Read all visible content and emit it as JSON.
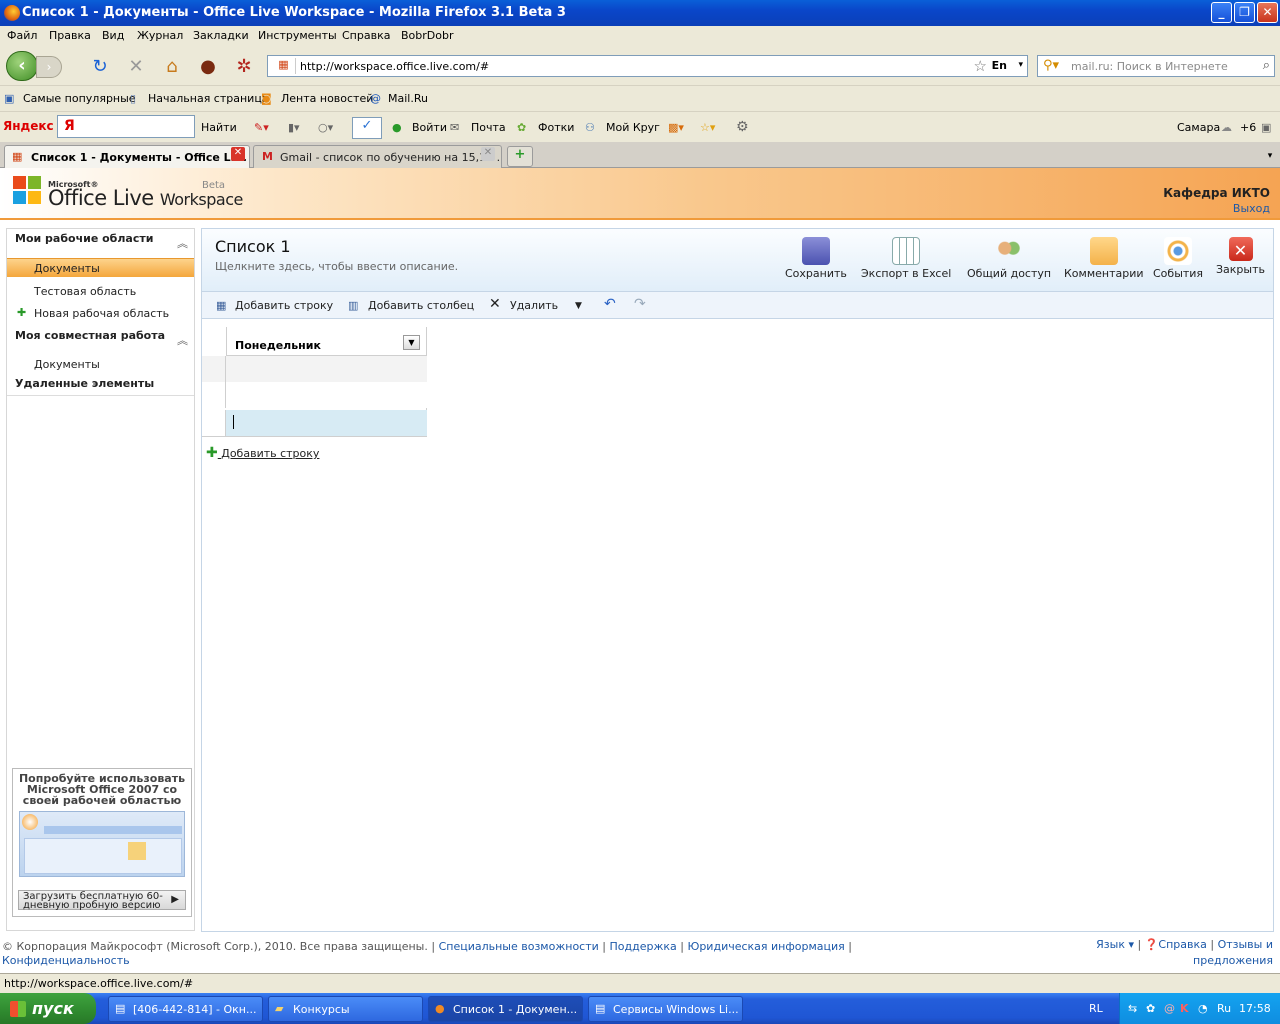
{
  "window": {
    "title": "Список 1 - Документы - Office Live Workspace - Mozilla Firefox 3.1 Beta 3"
  },
  "menu": [
    "Файл",
    "Правка",
    "Вид",
    "Журнал",
    "Закладки",
    "Инструменты",
    "Справка",
    "BobrDobr"
  ],
  "nav": {
    "url": "http://workspace.office.live.com/#",
    "lang_badge": "En",
    "search_placeholder": "mail.ru: Поиск в Интернете"
  },
  "bookmarks": [
    "Самые популярные",
    "Начальная страница",
    "Лента новостей",
    "Mail.Ru"
  ],
  "yandex": {
    "brand": "Яндекс",
    "find": "Найти",
    "login": "Войти",
    "mail": "Почта",
    "photos": "Фотки",
    "circle": "Мой Круг",
    "city": "Самара",
    "temp": "+6"
  },
  "tabs": [
    {
      "label": "Список 1 - Документы - Office Li..."
    },
    {
      "label": "Gmail - список по обучению на 15,16 ..."
    }
  ],
  "header": {
    "logo_ms": "Microsoft®",
    "logo_office": "Office Live",
    "logo_ws": "Workspace",
    "logo_beta": "Beta",
    "account": "Кафедра ИКТО",
    "logout": "Выход"
  },
  "sidebar": {
    "my_workspaces": "Мои рабочие области",
    "items1": [
      "Документы",
      "Тестовая область"
    ],
    "new_workspace": "Новая рабочая область",
    "shared": "Моя совместная работа",
    "items2": [
      "Документы"
    ],
    "deleted": "Удаленные элементы",
    "promo_title": "Попробуйте использовать Microsoft Office 2007 со своей рабочей областью",
    "promo_btn": "Загрузить бесплатную 60-дневную пробную версию"
  },
  "doc": {
    "title": "Список 1",
    "desc": "Щелкните здесь, чтобы ввести описание.",
    "actions": [
      "Сохранить",
      "Экспорт в Excel",
      "Общий доступ",
      "Комментарии",
      "События",
      "Закрыть"
    ],
    "toolbar": {
      "add_row": "Добавить строку",
      "add_col": "Добавить столбец",
      "delete": "Удалить"
    },
    "column": "Понедельник",
    "add_row_link": "Добавить строку"
  },
  "footer": {
    "copyright": "© Корпорация Майкрософт (Microsoft Corp.), 2010. Все права защищены. |",
    "links": [
      "Специальные возможности",
      "Поддержка",
      "Юридическая информация"
    ],
    "privacy": "Конфиденциальность",
    "lang": "Язык ▾",
    "help": "Справка",
    "feedback1": "Отзывы и",
    "feedback2": "предложения"
  },
  "status": "http://workspace.office.live.com/#",
  "taskbar": {
    "start": "пуск",
    "tasks": [
      "[406-442-814] - Окн...",
      "Конкурсы",
      "Список 1 - Докумен...",
      "Сервисы Windows Li..."
    ],
    "layout": "RL",
    "tray_lang": "Ru",
    "clock": "17:58"
  },
  "colors": {
    "accent": "#f4a63c",
    "link": "#1c58a8",
    "taskbar": "#245edb"
  }
}
